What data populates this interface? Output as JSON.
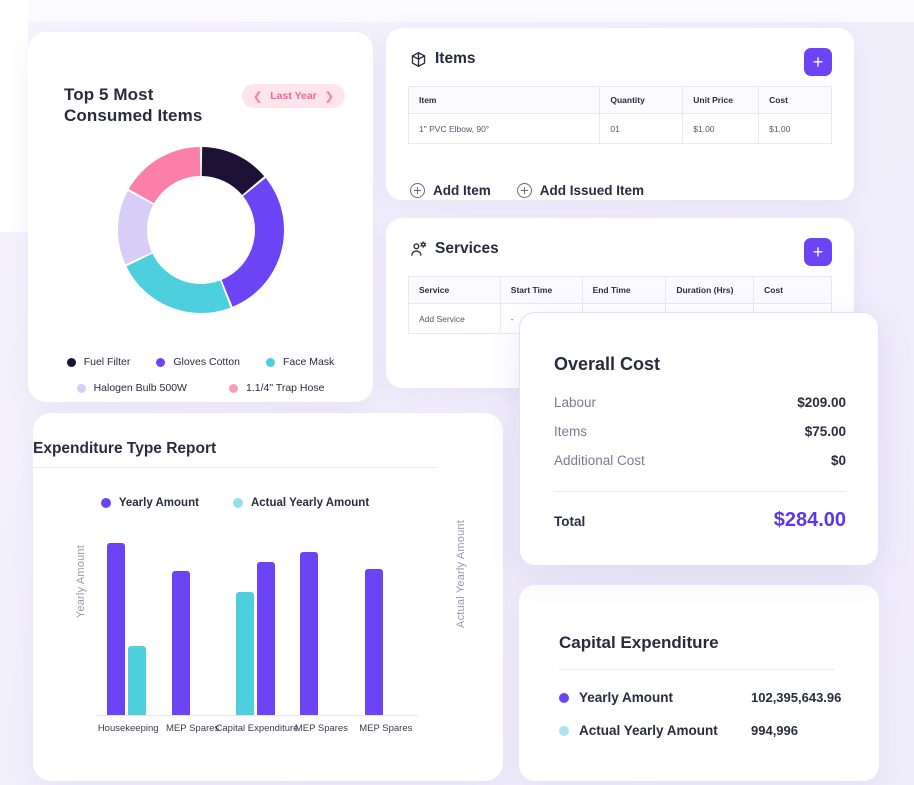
{
  "theme": {
    "page_bg": "#f2effc",
    "card_bg": "#ffffff",
    "accent_purple": "#6c43f5",
    "accent_cyan": "#4dcfde",
    "accent_pink": "#fb7fa9",
    "text_dark": "#2b2b40",
    "text_muted": "#7b7b92"
  },
  "donut_card": {
    "title": "Top 5 Most\nConsumed Items",
    "title_line1": "Top 5 Most",
    "title_line2": "Consumed Items",
    "period_pill": {
      "prev_icon": "chevron-left-icon",
      "label": "Last Year",
      "next_icon": "chevron-right-icon"
    },
    "chart_data": {
      "type": "pie",
      "title": "Top 5 Most Consumed Items",
      "labels": [
        "Fuel Filter",
        "Gloves Cotton",
        "Face Mask",
        "Halogen Bulb 500W",
        "1.1/4\" Trap Hose"
      ],
      "values": [
        14,
        30,
        24,
        15,
        17
      ],
      "colors": [
        "#1d1236",
        "#6c43f5",
        "#4dcfde",
        "#d7cdf8",
        "#fb7fa9"
      ],
      "donut": true,
      "legend_position": "bottom"
    },
    "legend_row1": [
      {
        "label": "Fuel Filter",
        "color": "#1d1236"
      },
      {
        "label": "Gloves Cotton",
        "color": "#6c43f5"
      },
      {
        "label": "Face Mask",
        "color": "#4dcfde"
      }
    ],
    "legend_row2": [
      {
        "label": "Halogen Bulb 500W",
        "color": "#d7cdf8"
      },
      {
        "label": "1.1/4\" Trap Hose",
        "color": "#fb7fa9"
      }
    ]
  },
  "expenditure_card": {
    "title": "Expenditure Type Report",
    "chart_data": {
      "type": "bar",
      "title": "Expenditure Type Report",
      "xlabel": "",
      "ylabel": "Yearly Amount",
      "ylabel_right": "Actual Yearly Amount",
      "categories": [
        "Housekeeping",
        "MEP Spares",
        "Capital Expenditure",
        "MEP Spares",
        "MEP Spares"
      ],
      "series": [
        {
          "name": "Yearly Amount",
          "color": "#6c43f5",
          "values": [
            92,
            77,
            82,
            87,
            78
          ]
        },
        {
          "name": "Actual Yearly Amount",
          "color": "#4dcfde",
          "values": [
            37,
            0,
            66,
            0,
            0
          ]
        }
      ],
      "ylim": [
        0,
        100
      ],
      "grid": false,
      "legend_position": "top"
    },
    "legend": [
      {
        "label": "Yearly Amount",
        "color": "#6c43f5"
      },
      {
        "label": "Actual Yearly Amount",
        "color": "#8fe3ec"
      }
    ],
    "y_axis_left": "Yearly Amount",
    "y_axis_right": "Actual Yearly Amount"
  },
  "items_card": {
    "icon": "box-icon",
    "title": "Items",
    "add_button": "+",
    "columns": [
      "Item",
      "Quantity",
      "Unit Price",
      "Cost"
    ],
    "rows": [
      {
        "item": "1\" PVC Elbow, 90°",
        "quantity": "01",
        "unit_price": "$1.00",
        "cost": "$1.00"
      }
    ],
    "actions": [
      {
        "icon": "circle-plus-icon",
        "label": "Add Item"
      },
      {
        "icon": "circle-plus-icon",
        "label": "Add Issued Item"
      }
    ]
  },
  "services_card": {
    "icon": "user-gear-icon",
    "title": "Services",
    "add_button": "+",
    "columns": [
      "Service",
      "Start Time",
      "End Time",
      "Duration (Hrs)",
      "Cost"
    ],
    "rows": [
      {
        "service": "Add Service",
        "start_time": "-",
        "end_time": "",
        "duration": "",
        "cost": ""
      }
    ]
  },
  "overall_cost_card": {
    "title": "Overall Cost",
    "rows": [
      {
        "label": "Labour",
        "value": "$209.00"
      },
      {
        "label": "Items",
        "value": "$75.00"
      },
      {
        "label": "Additional Cost",
        "value": "$0"
      }
    ],
    "total_label": "Total",
    "total_value": "$284.00"
  },
  "capital_expenditure_card": {
    "title": "Capital Expenditure",
    "rows": [
      {
        "label": "Yearly Amount",
        "value": "102,395,643.96",
        "color": "#6c43f5"
      },
      {
        "label": "Actual Yearly Amount",
        "value": "994,996",
        "color": "#a8e6ee"
      }
    ]
  }
}
